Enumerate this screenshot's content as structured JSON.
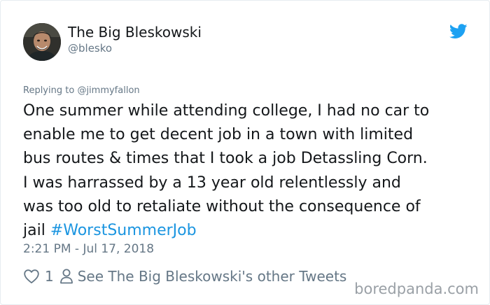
{
  "user": {
    "display_name": "The Big Bleskowski",
    "handle": "@blesko"
  },
  "icons": {
    "brand": "twitter-bird-icon",
    "like": "heart-outline-icon",
    "profile": "person-outline-icon"
  },
  "colors": {
    "brand_blue": "#1da1f2",
    "link_blue": "#1b95e0",
    "secondary_text": "#657786",
    "primary_text": "#14171a"
  },
  "tweet": {
    "replying_prefix": "Replying to",
    "replying_to": "@jimmyfallon",
    "lines": [
      "One summer while attending college, I had no car to",
      "enable me to get decent job in a town with limited",
      "bus routes & times that I took a job Detassling Corn.",
      "I was harrassed by a 13 year old relentlessly and",
      "was too old to retaliate without the consequence of",
      "jail"
    ],
    "hashtag": "#WorstSummerJob",
    "timestamp": "2:21 PM - Jul 17, 2018"
  },
  "actions": {
    "like_count": "1",
    "see_other_label": "See The Big Bleskowski's other Tweets"
  },
  "watermark": "boredpanda.com"
}
